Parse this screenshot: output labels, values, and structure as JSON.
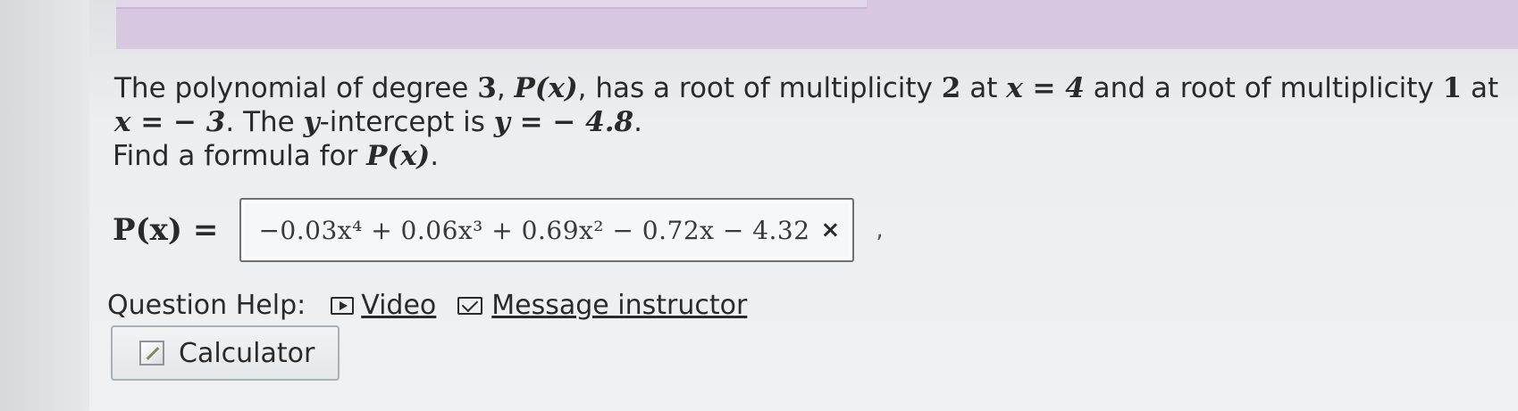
{
  "question": {
    "t1": "The polynomial of degree ",
    "degree": "3",
    "t2": ", ",
    "px": "P(x)",
    "t3": ", has a root of multiplicity ",
    "mult1": "2",
    "t4": " at ",
    "root1": "x = 4",
    "t5": " and a root of multiplicity ",
    "mult2": "1",
    "t6": " at ",
    "root2": "x = − 3",
    "t7": ". The ",
    "yvar": "y",
    "t8": "-intercept is ",
    "yint": "y = − 4.8",
    "t9": ".",
    "find_text": "Find a formula for ",
    "find_px": "P(x)",
    "find_end": "."
  },
  "answer": {
    "label": "P(x) =",
    "value": "−0.03x⁴ + 0.06x³ + 0.69x² − 0.72x − 4.32",
    "status_icon": "×",
    "trailing": ","
  },
  "help": {
    "label": "Question Help:",
    "video_label": "Video",
    "message_label": "Message instructor"
  },
  "calculator": {
    "label": "Calculator"
  },
  "icons": {
    "video": "video-icon",
    "message": "mail-icon",
    "calculator": "calculator-icon",
    "status": "x-mark-icon"
  },
  "colors": {
    "top_band": "#d7c8e0",
    "text": "#2a2a2a",
    "box_border": "#6f6f6f"
  }
}
